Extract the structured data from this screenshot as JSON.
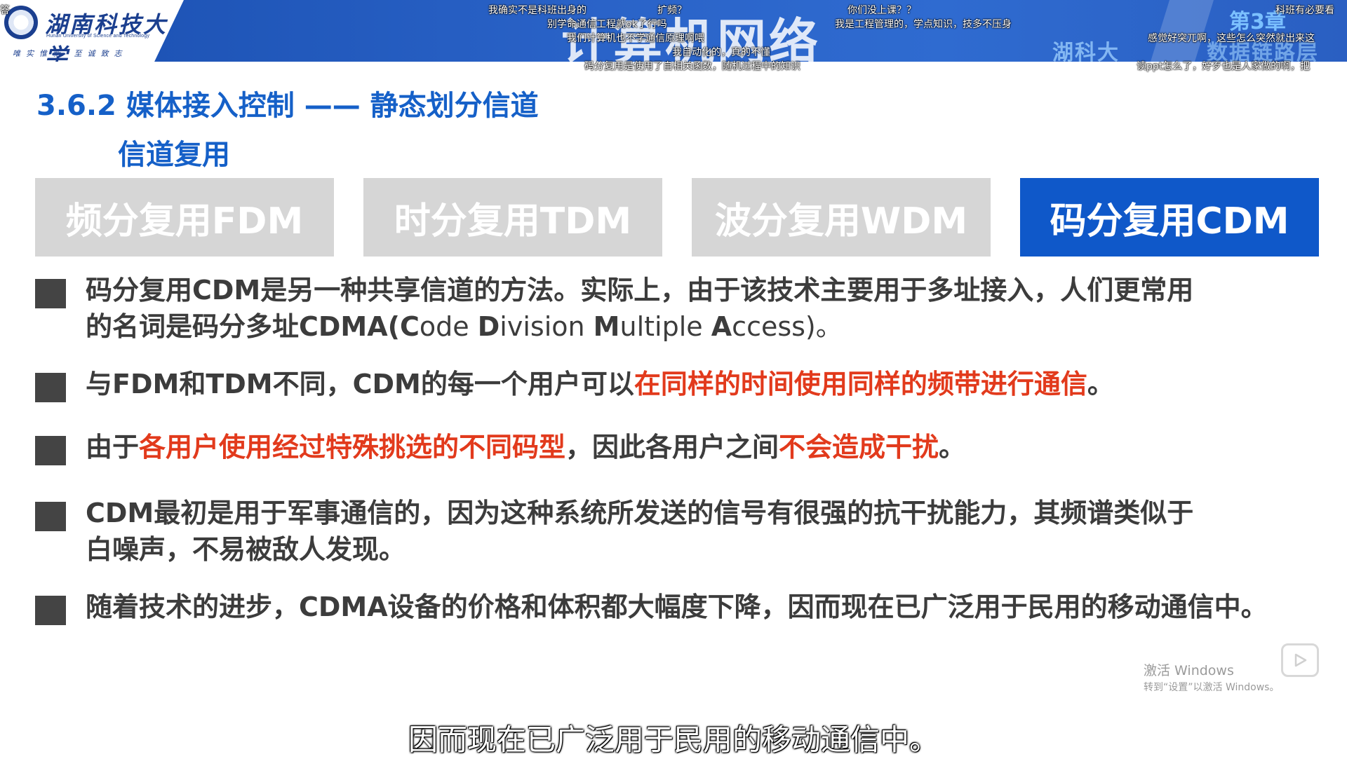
{
  "header": {
    "logo_cn": "湖南科技大学",
    "logo_en": "Hunan University of Science and Technology",
    "logo_motto": "唯实惟新  至诚致志",
    "course_title": "计算机网络",
    "chapter_label": "第3章",
    "chapter_sub": "湖科大",
    "chapter_sub2": "数据链路层"
  },
  "danmaku": [
    "答",
    "我确实不是科班出身的",
    "别学命通信工程就ok了行吗",
    "扩频？",
    "你们没上课？？",
    "我是工程管理的，学点知识，技多不压身",
    "我们计算机也不学通信原理啊喂",
    "我自动化的，真的不懂",
    "码分复用是使用了自相关函数，随机过程中的知识",
    "感觉好突兀啊，这些怎么突然就出来这",
    "读ppt怎么了，好歹也是人家做的啊，把",
    "科班有必要看"
  ],
  "slide": {
    "section_title": "3.6.2 媒体接入控制 —— 静态划分信道",
    "section_sub": "信道复用",
    "tabs": [
      {
        "label": "频分复用FDM",
        "active": false
      },
      {
        "label": "时分复用TDM",
        "active": false
      },
      {
        "label": "波分复用WDM",
        "active": false
      },
      {
        "label": "码分复用CDM",
        "active": true
      }
    ],
    "bullets": [
      {
        "line1": "码分复用CDM是另一种共享信道的方法。实际上，由于该技术主要用于多址接入，人们更常用",
        "line2_a": "的名词是码分多址CDMA(",
        "line2_C": "C",
        "line2_b": "ode ",
        "line2_D": "D",
        "line2_c": "ivision ",
        "line2_M": "M",
        "line2_d": "ultiple ",
        "line2_A": "A",
        "line2_e": "ccess)。"
      },
      {
        "pre": "与FDM和TDM不同，CDM的每一个用户可以",
        "red": "在同样的时间使用同样的频带进行通信",
        "post": "。"
      },
      {
        "pre": "由于",
        "red1": "各用户使用经过特殊挑选的不同码型",
        "mid": "，因此各用户之间",
        "red2": "不会造成干扰",
        "post": "。"
      },
      {
        "line1": "CDM最初是用于军事通信的，因为这种系统所发送的信号有很强的抗干扰能力，其频谱类似于",
        "line2": "白噪声，不易被敌人发现。"
      },
      {
        "line1": "随着技术的进步，CDMA设备的价格和体积都大幅度下降，因而现在已广泛用于民用的移动通信中。"
      }
    ]
  },
  "overlay": {
    "windows_watermark_1": "激活 Windows",
    "windows_watermark_2": "转到“设置”以激活 Windows。",
    "subtitle": "因而现在已广泛用于民用的移动通信中。"
  },
  "colors": {
    "title_blue": "#1560c8",
    "active_tab": "#0f58c9",
    "inactive_tab": "#d6d6d6",
    "highlight_red": "#e23a1c",
    "body_text": "#3c3c3c"
  }
}
